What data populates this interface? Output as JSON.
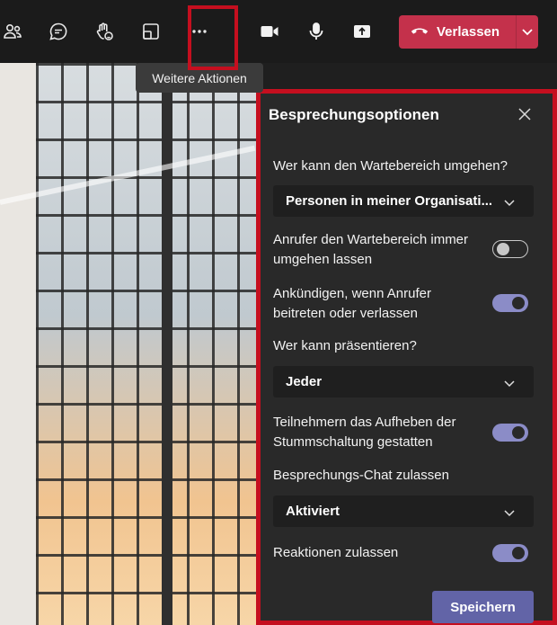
{
  "toolbar": {
    "icons": [
      "participants-icon",
      "chat-icon",
      "raise-hand-icon",
      "rooms-icon",
      "more-actions-icon",
      "camera-icon",
      "microphone-icon",
      "share-icon"
    ],
    "leave_label": "Verlassen",
    "tooltip": "Weitere Aktionen",
    "leave_color": "#c4314b"
  },
  "panel": {
    "title": "Besprechungsoptionen",
    "lobby_question": "Wer kann den Wartebereich umgehen?",
    "lobby_value": "Personen in meiner Organisati...",
    "callers_bypass_line1": "Anrufer den Wartebereich immer",
    "callers_bypass_line2": "umgehen lassen",
    "callers_bypass_on": false,
    "announce_line1": "Ankündigen, wenn Anrufer",
    "announce_line2": "beitreten oder verlassen",
    "announce_on": true,
    "present_question": "Wer kann präsentieren?",
    "present_value": "Jeder",
    "unmute_line1": "Teilnehmern das Aufheben der",
    "unmute_line2": "Stummschaltung gestatten",
    "unmute_on": true,
    "chat_question": "Besprechungs-Chat zulassen",
    "chat_value": "Aktiviert",
    "reactions_label": "Reaktionen zulassen",
    "reactions_on": true,
    "save_label": "Speichern",
    "accent_color": "#6264a7",
    "highlight_color": "#c50f1f"
  }
}
